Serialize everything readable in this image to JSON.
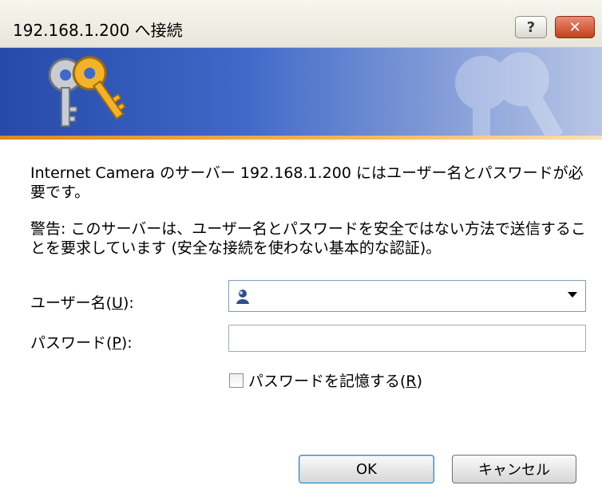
{
  "window": {
    "title": "192.168.1.200 へ接続",
    "help_button": "?",
    "close_button": "✕"
  },
  "banner": {
    "icon": "keys-icon",
    "watermark_icon": "keys-watermark-icon"
  },
  "message": {
    "line1": "Internet Camera のサーバー 192.168.1.200 にはユーザー名とパスワードが必要です。",
    "line2": "警告: このサーバーは、ユーザー名とパスワードを安全ではない方法で送信することを要求しています (安全な接続を使わない基本的な認証)。"
  },
  "form": {
    "username_label_prefix": "ユーザー名(",
    "username_label_key": "U",
    "username_label_suffix": "):",
    "username_value": "",
    "username_icon": "user-account-icon",
    "password_label_prefix": "パスワード(",
    "password_label_key": "P",
    "password_label_suffix": "):",
    "password_value": "",
    "remember_prefix": "パスワードを記憶する(",
    "remember_key": "R",
    "remember_suffix": ")",
    "remember_checked": false
  },
  "buttons": {
    "ok": "OK",
    "cancel": "キャンセル"
  },
  "colors": {
    "banner_start": "#264aa8",
    "accent_orange": "#d98a1e",
    "close_red": "#c5401c",
    "input_border": "#7f9db9"
  }
}
